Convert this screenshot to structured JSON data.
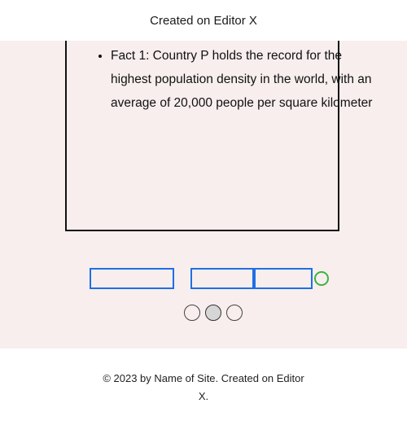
{
  "header": {
    "title": "Created on Editor X"
  },
  "facts": [
    {
      "text": "Fact 1: Country P holds the record for the highest population density in the world, with an average of 20,000 people per square kilometer"
    }
  ],
  "buttons": [
    {
      "label": ""
    },
    {
      "label": ""
    },
    {
      "label": ""
    }
  ],
  "pager": {
    "pages": 3,
    "active_index": 2
  },
  "footer": {
    "text": "© 2023 by Name of Site. Created on Editor X."
  },
  "colors": {
    "page_background": "#f8eeee",
    "button_border": "#1f6fe5",
    "text": "#111111"
  }
}
